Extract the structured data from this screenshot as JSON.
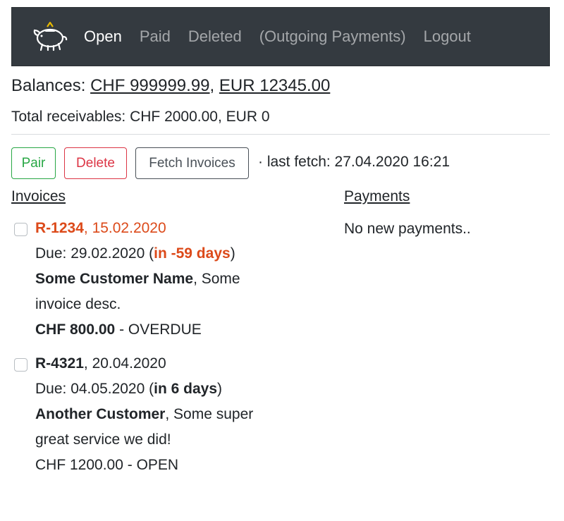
{
  "nav": {
    "logo_icon": "piggy-bank-icon",
    "items": [
      {
        "label": "Open",
        "active": true
      },
      {
        "label": "Paid",
        "active": false
      },
      {
        "label": "Deleted",
        "active": false
      },
      {
        "label": "(Outgoing Payments)",
        "active": false
      },
      {
        "label": "Logout",
        "active": false
      }
    ]
  },
  "balances": {
    "label": "Balances: ",
    "chf": "CHF 999999.99",
    "separator": ", ",
    "eur": "EUR 12345.00"
  },
  "receivables": "Total receivables: CHF 2000.00, EUR 0",
  "actions": {
    "pair": "Pair",
    "delete": "Delete",
    "fetch": "Fetch Invoices",
    "last_fetch": "· last fetch: 27.04.2020 16:21"
  },
  "invoices": {
    "heading": "Invoices",
    "items": [
      {
        "number": "R-1234",
        "date_sep": ", ",
        "date": "15.02.2020",
        "due_label": "Due: 29.02.2020 (",
        "due_rel": "in -59 days",
        "due_close": ")",
        "customer": "Some Customer Name",
        "desc1": ", Some",
        "desc2": "invoice desc.",
        "amount": "CHF 800.00",
        "status": " - OVERDUE"
      },
      {
        "number": "R-4321",
        "date_sep": ", ",
        "date": "20.04.2020",
        "due_label": "Due: 04.05.2020 (",
        "due_rel": "in 6 days",
        "due_close": ")",
        "customer": "Another Customer",
        "desc1": ", Some super",
        "desc2": "great service we did!",
        "amount": "CHF 1200.00",
        "status": " - OPEN"
      }
    ]
  },
  "payments": {
    "heading": "Payments",
    "empty": "No new payments.."
  },
  "colors": {
    "navbar": "#343a40",
    "overdue": "#dc4a1a",
    "pair": "#28a745",
    "delete": "#dc3545",
    "fetch": "#495057"
  }
}
